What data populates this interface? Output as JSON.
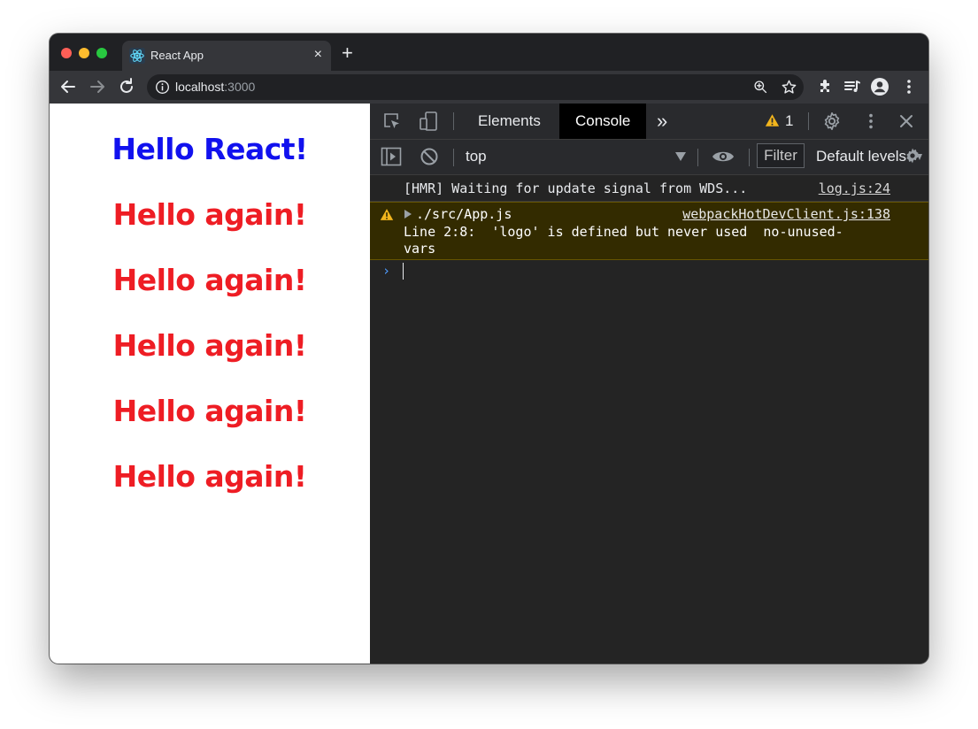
{
  "browser": {
    "tab_title": "React App",
    "tab_close": "×",
    "new_tab": "+",
    "url_host": "localhost",
    "url_port": ":3000"
  },
  "page": {
    "heading": "Hello React!",
    "repeated": [
      "Hello again!",
      "Hello again!",
      "Hello again!",
      "Hello again!",
      "Hello again!"
    ],
    "heading_color": "#1111ee",
    "repeated_color": "#ee1d24"
  },
  "devtools": {
    "tabs": [
      "Elements",
      "Console"
    ],
    "active_tab": "Console",
    "more_tabs": "»",
    "warning_count": "1",
    "context": "top",
    "filter_label": "Filter",
    "levels_label": "Default levels",
    "messages": [
      {
        "type": "log",
        "text": "[HMR] Waiting for update signal from WDS...",
        "source": "log.js:24"
      },
      {
        "type": "warning",
        "file": "./src/App.js",
        "source": "webpackHotDevClient.js:138",
        "detail": "Line 2:8:  'logo' is defined but never used  no-unused-vars"
      }
    ],
    "prompt": "›"
  }
}
